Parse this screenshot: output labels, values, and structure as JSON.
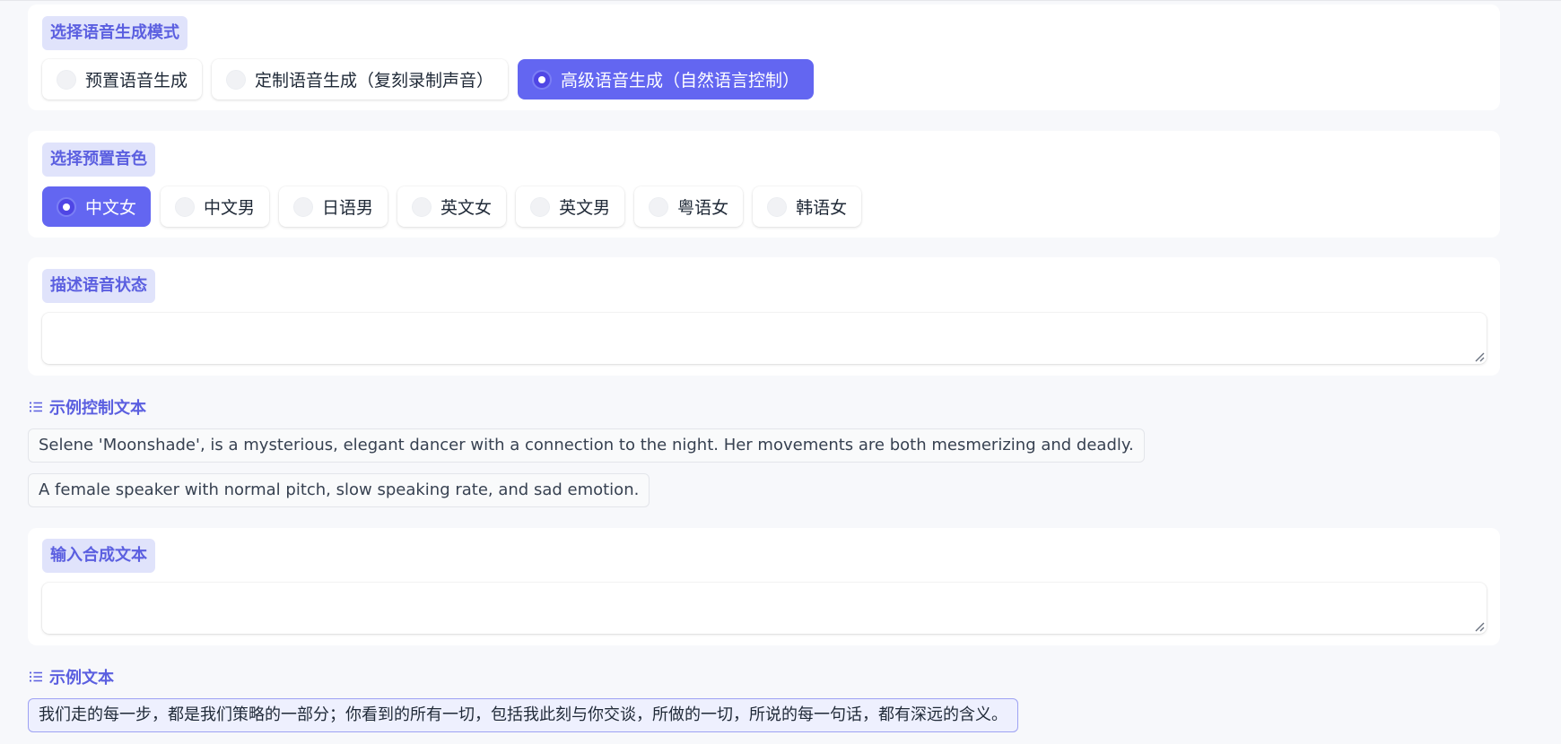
{
  "mode": {
    "label": "选择语音生成模式",
    "options": [
      "预置语音生成",
      "定制语音生成（复刻录制声音）",
      "高级语音生成（自然语言控制）"
    ],
    "selected": "高级语音生成（自然语言控制）"
  },
  "voice": {
    "label": "选择预置音色",
    "options": [
      "中文女",
      "中文男",
      "日语男",
      "英文女",
      "英文男",
      "粤语女",
      "韩语女"
    ],
    "selected": "中文女"
  },
  "describe": {
    "label": "描述语音状态",
    "value": ""
  },
  "control_examples": {
    "header": "示例控制文本",
    "items": [
      "Selene 'Moonshade', is a mysterious, elegant dancer with a connection to the night. Her movements are both mesmerizing and deadly.",
      "A female speaker with normal pitch, slow speaking rate, and sad emotion."
    ]
  },
  "synth": {
    "label": "输入合成文本",
    "value": ""
  },
  "text_examples": {
    "header": "示例文本",
    "items": [
      "我们走的每一步，都是我们策略的一部分；你看到的所有一切，包括我此刻与你交谈，所做的一切，所说的每一句话，都有深远的含义。"
    ]
  },
  "colors": {
    "accent": "#6366f1",
    "label_bg": "#e0e3fb",
    "label_text": "#5b5fe0",
    "page_bg": "#f7f8fb"
  }
}
